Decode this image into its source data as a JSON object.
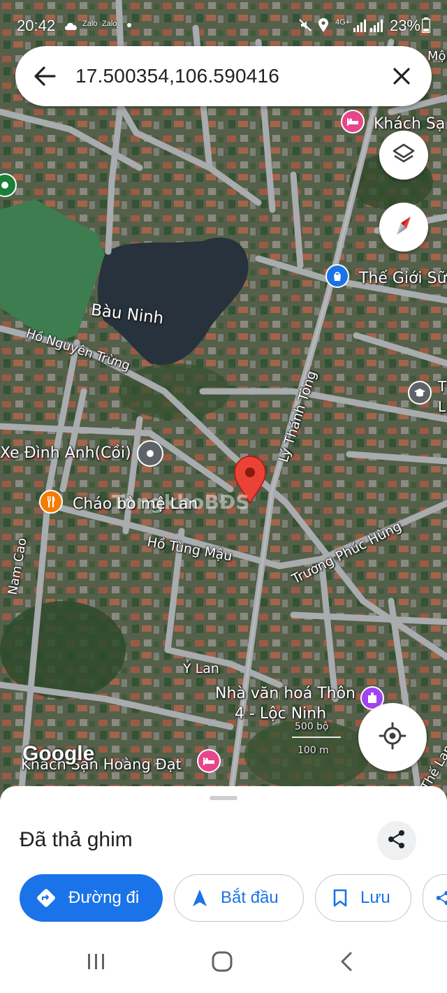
{
  "status_bar": {
    "time": "20:42",
    "notif_1": "Zalo",
    "notif_2": "Zalo",
    "network": "4G+",
    "battery": "23%"
  },
  "search": {
    "query": "17.500354,106.590416"
  },
  "map": {
    "labels": {
      "lake": "Bàu Ninh",
      "road_ho_nguyen_trung": "Hồ Nguyên Trừng",
      "road_ly_thanh_tong": "Lý Thánh Tông",
      "road_ho_tung_mau": "Hồ Tùng Mậu",
      "road_truong_phuc_hung": "Trương Phúc Hùng",
      "road_nam_cao": "Nam Cao",
      "road_y_lan": "Ỷ Lan",
      "road_the_lan": "Thế Lan",
      "poi_khach_san_top": "Khách Sạ",
      "poi_the_gioi": "Thế Giới Sữ",
      "poi_school_t": "T",
      "poi_school_l": "L",
      "poi_xe_dinh_anh": "Xe Đình Anh(Cồi)",
      "poi_chao_bo": "Cháo bò mệ Lan",
      "poi_nha_van_hoa_1": "Nhà văn hoá Thôn",
      "poi_nha_van_hoa_2": "4 - Lộc Ninh",
      "poi_khach_san_bottom": "Khách Sạn Hoàng Đạt",
      "poi_mo": "Mộ",
      "scale_500": "500 bộ",
      "scale_100": "100 m",
      "google_logo": "Google",
      "watermark": "TongkhoBĐS"
    },
    "colors": {
      "road": "#a8acae",
      "water": "#28323d",
      "pin_red": "#ea4335",
      "hotel_pink": "#e8458b",
      "shop_blue": "#1a73e8",
      "purple": "#a142f4",
      "green": "#188038",
      "gray_pin": "#5f6368",
      "food_orange": "#f57c00",
      "field_green": "#3d7d4f"
    }
  },
  "sheet": {
    "title": "Đã thả ghim",
    "share_icon": "share-icon",
    "actions": [
      {
        "label": "Đường đi",
        "icon": "directions-icon"
      },
      {
        "label": "Bắt đầu",
        "icon": "navigation-arrow-icon"
      },
      {
        "label": "Lưu",
        "icon": "bookmark-icon"
      }
    ]
  },
  "accent": "#1a73e8"
}
